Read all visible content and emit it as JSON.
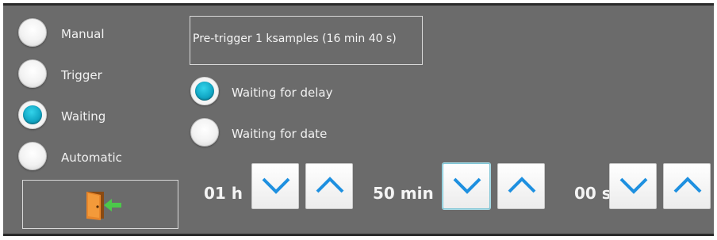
{
  "mode_options": [
    {
      "label": "Manual",
      "checked": false
    },
    {
      "label": "Trigger",
      "checked": false
    },
    {
      "label": "Waiting",
      "checked": true
    },
    {
      "label": "Automatic",
      "checked": false
    }
  ],
  "exit_button": {
    "icon": "exit-door-icon"
  },
  "pretrigger": {
    "text": "Pre-trigger 1 ksamples (16 min 40 s)"
  },
  "waiting_options": [
    {
      "label": "Waiting for delay",
      "checked": true
    },
    {
      "label": "Waiting for date",
      "checked": false
    }
  ],
  "delay": {
    "hours": "01 h",
    "minutes": "50 min",
    "seconds": "00 s"
  },
  "colors": {
    "panel_bg": "#6b6b6b",
    "accent_cyan": "#12a8c6",
    "arrow_blue": "#1e90e0",
    "door_orange": "#e8862a",
    "arrow_green": "#4cc84a"
  }
}
